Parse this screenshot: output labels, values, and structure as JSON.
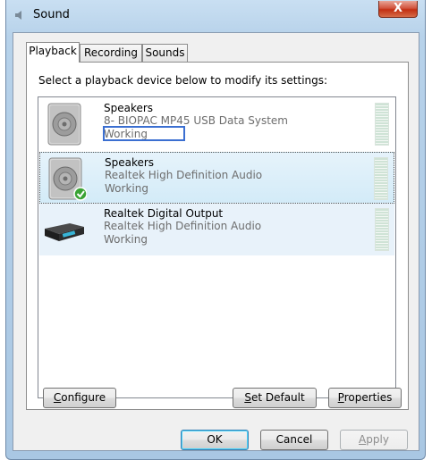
{
  "window": {
    "title": "Sound",
    "close_glyph": "X"
  },
  "tabs": [
    {
      "label": "Playback"
    },
    {
      "label": "Recording"
    },
    {
      "label": "Sounds"
    }
  ],
  "instruction": "Select a playback device below to modify its settings:",
  "devices": [
    {
      "name": "Speakers",
      "description": "8- BIOPAC MP45 USB Data System",
      "status": "Working",
      "icon": "speaker-icon"
    },
    {
      "name": "Speakers",
      "description": "Realtek High Definition Audio",
      "status": "Working",
      "icon": "speaker-icon",
      "default_badge": "green-check-icon"
    },
    {
      "name": "Realtek Digital Output",
      "description": "Realtek High Definition Audio",
      "status": "Working",
      "icon": "digital-receiver-icon"
    }
  ],
  "buttons": {
    "configure": {
      "mn": "C",
      "rest": "onfigure"
    },
    "set_default": {
      "mn": "S",
      "rest": "et Default"
    },
    "properties": {
      "mn": "P",
      "rest": "roperties"
    },
    "ok": "OK",
    "cancel": "Cancel",
    "apply": {
      "mn": "A",
      "rest": "pply"
    }
  }
}
